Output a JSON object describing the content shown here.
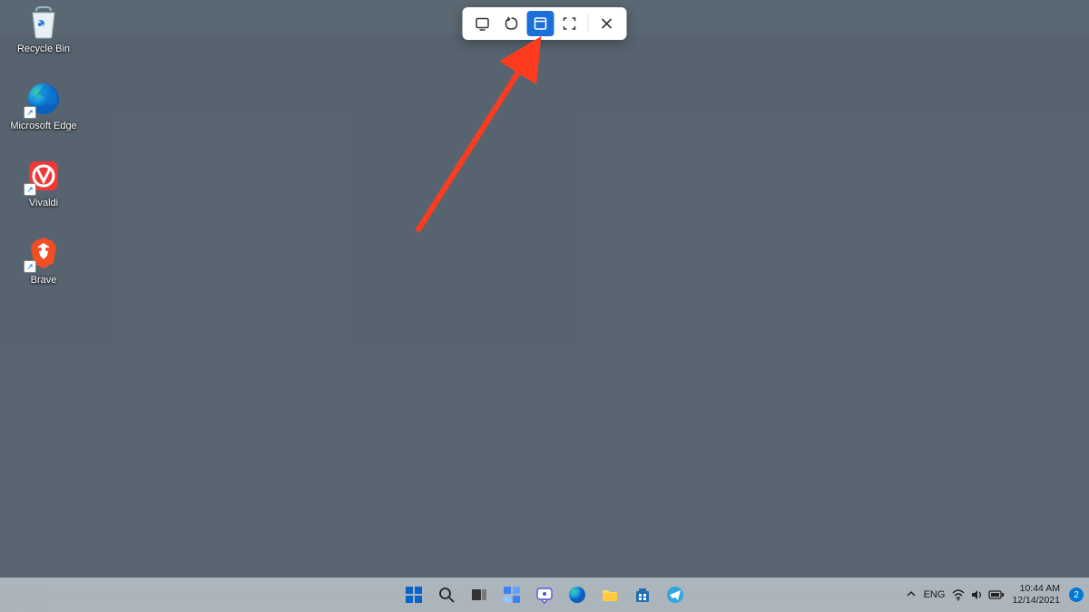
{
  "desktop_icons": [
    {
      "id": "recycle-bin",
      "label": "Recycle Bin",
      "shortcut": false
    },
    {
      "id": "microsoft-edge",
      "label": "Microsoft Edge",
      "shortcut": true
    },
    {
      "id": "vivaldi",
      "label": "Vivaldi",
      "shortcut": true
    },
    {
      "id": "brave",
      "label": "Brave",
      "shortcut": true
    }
  ],
  "snip_toolbar": {
    "buttons": [
      {
        "id": "rectangular-snip",
        "active": false
      },
      {
        "id": "freeform-snip",
        "active": false
      },
      {
        "id": "window-snip",
        "active": true
      },
      {
        "id": "fullscreen-snip",
        "active": false
      }
    ],
    "close": "close"
  },
  "taskbar": {
    "apps": [
      "start",
      "search",
      "task-view",
      "widgets",
      "chat",
      "edge",
      "file-explorer",
      "microsoft-store",
      "telegram"
    ]
  },
  "systray": {
    "overflow": "chevron-up",
    "language": "ENG",
    "icons": [
      "wifi",
      "volume",
      "battery"
    ],
    "time": "10:44 AM",
    "date": "12/14/2021",
    "notifications": "2"
  },
  "colors": {
    "accent": "#1a6fd8",
    "arrow": "#ff3b1f"
  }
}
